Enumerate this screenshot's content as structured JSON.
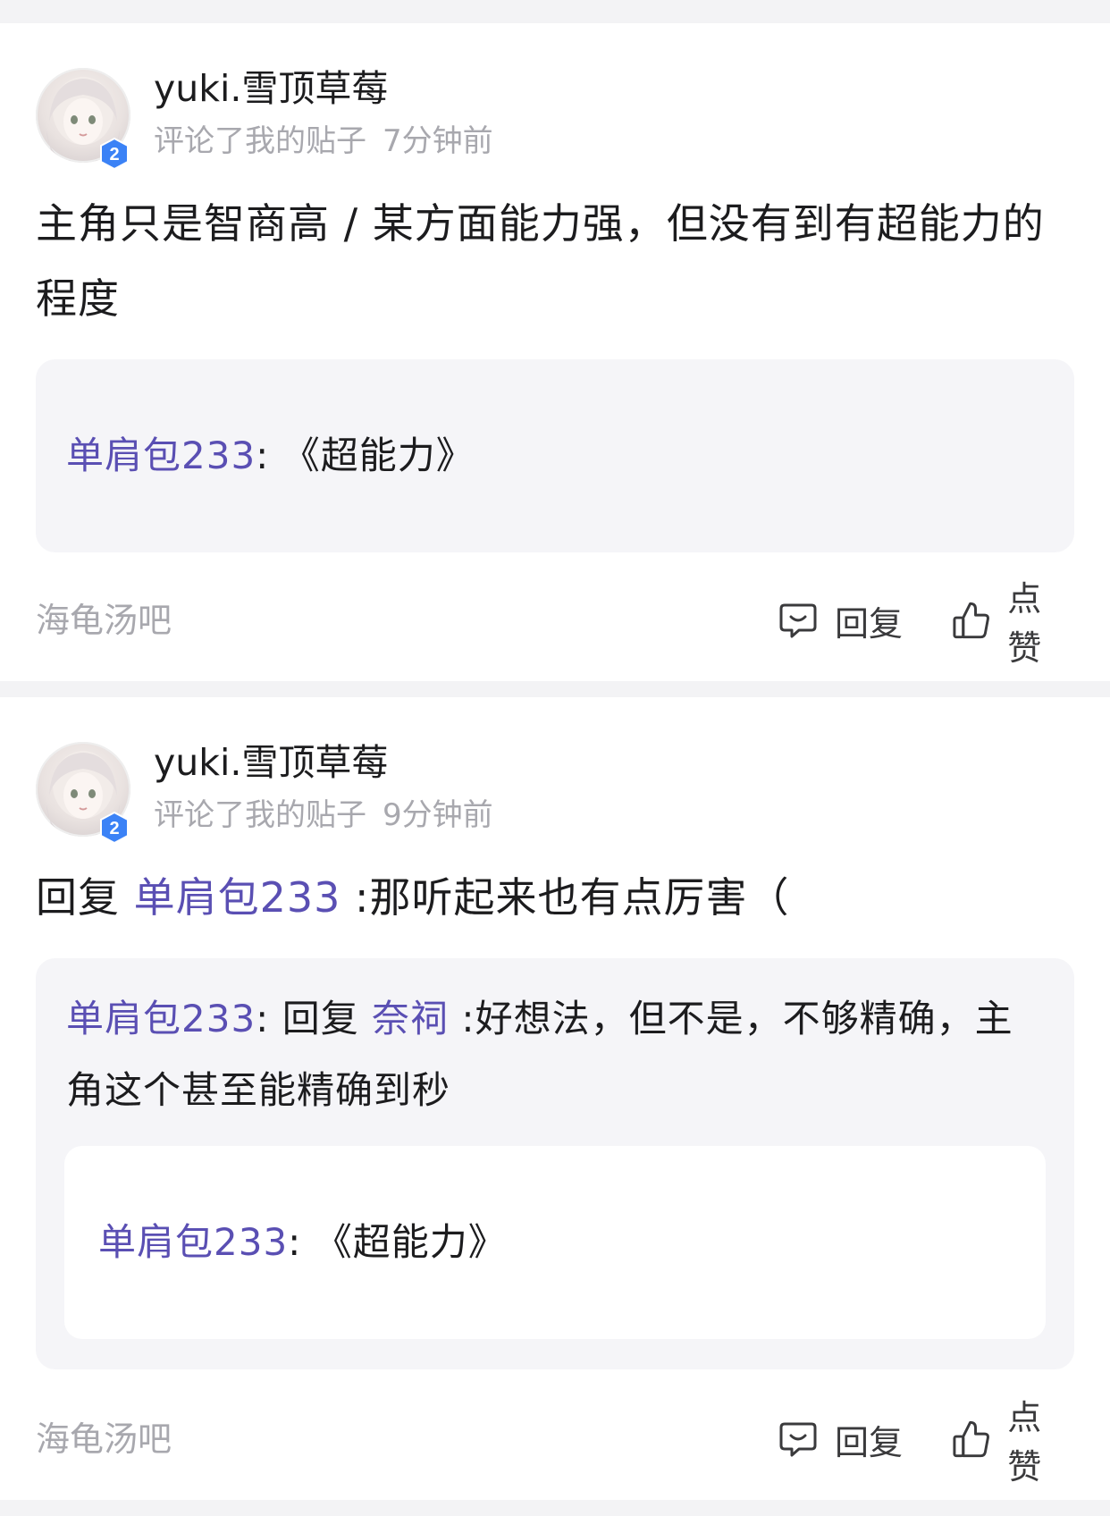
{
  "notifications": [
    {
      "username": "yuki.雪顶草莓",
      "level": "2",
      "action": "评论了我的贴子",
      "time": "7分钟前",
      "content": "主角只是智商高 / 某方面能力强，但没有到有超能力的程度",
      "quote": {
        "author": "单肩包233",
        "separator": ": ",
        "text": "《超能力》"
      },
      "forum": "海龟汤吧",
      "reply_label": "回复",
      "like_label": "点赞"
    },
    {
      "username": "yuki.雪顶草莓",
      "level": "2",
      "action": "评论了我的贴子",
      "time": "9分钟前",
      "content_prefix": "回复 ",
      "content_mention": "单肩包233",
      "content_text": " :那听起来也有点厉害（",
      "quote": {
        "author": "单肩包233",
        "separator": ": ",
        "reply_prefix": "回复 ",
        "mention": "奈祠",
        "text": " :好想法，但不是，不够精确，主角这个甚至能精确到秒"
      },
      "nested_quote": {
        "author": "单肩包233",
        "separator": ": ",
        "text": "《超能力》"
      },
      "forum": "海龟汤吧",
      "reply_label": "回复",
      "like_label": "点赞"
    }
  ],
  "colors": {
    "mention": "#5a4fb3",
    "secondary_text": "#a8a8ae",
    "quote_bg": "#f5f5f8",
    "badge": "#3b82f6"
  },
  "icons": {
    "reply": "comment-bubble-icon",
    "like": "thumbs-up-icon",
    "level": "level-badge-icon"
  }
}
